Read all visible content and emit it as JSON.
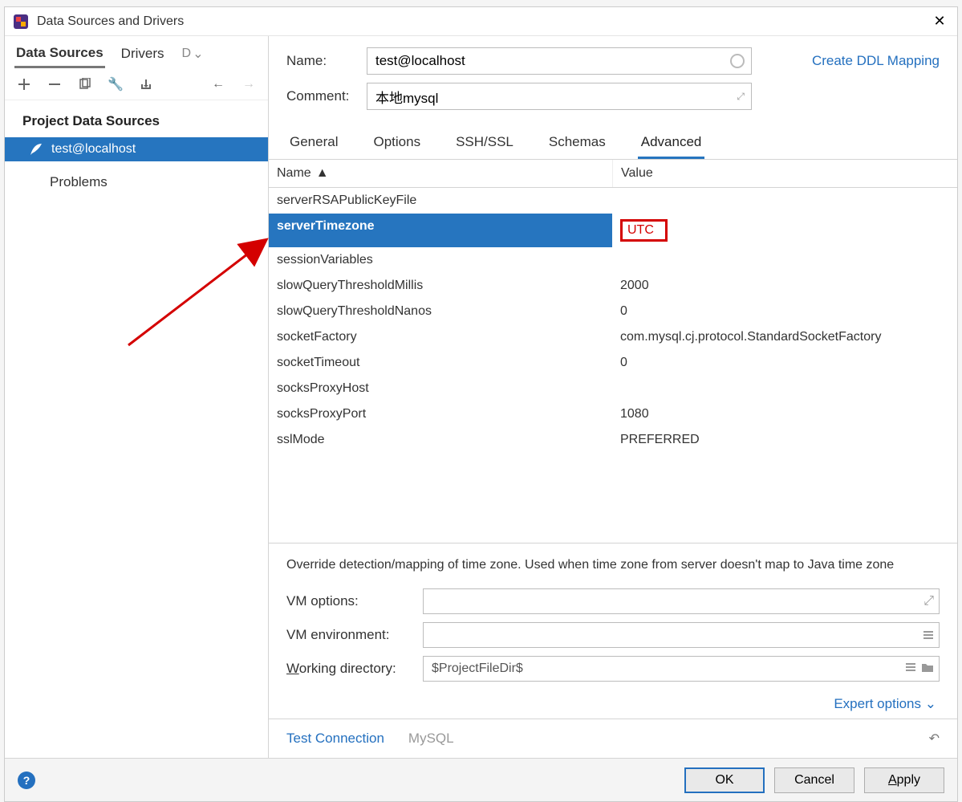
{
  "window": {
    "title": "Data Sources and Drivers"
  },
  "left": {
    "tabs": {
      "datasources": "Data Sources",
      "drivers": "Drivers",
      "ddl": "D"
    },
    "section": "Project Data Sources",
    "item": "test@localhost",
    "problems": "Problems"
  },
  "form": {
    "name_label": "Name:",
    "name_value": "test@localhost",
    "comment_label": "Comment:",
    "comment_value": "本地mysql",
    "ddl_link": "Create DDL Mapping"
  },
  "tabs": {
    "general": "General",
    "options": "Options",
    "ssh": "SSH/SSL",
    "schemas": "Schemas",
    "advanced": "Advanced"
  },
  "table": {
    "col_name": "Name",
    "col_value": "Value",
    "rows": [
      {
        "name": "serverRSAPublicKeyFile",
        "value": ""
      },
      {
        "name": "serverTimezone",
        "value": "UTC",
        "selected": true
      },
      {
        "name": "sessionVariables",
        "value": ""
      },
      {
        "name": "slowQueryThresholdMillis",
        "value": "2000"
      },
      {
        "name": "slowQueryThresholdNanos",
        "value": "0"
      },
      {
        "name": "socketFactory",
        "value": "com.mysql.cj.protocol.StandardSocketFactory"
      },
      {
        "name": "socketTimeout",
        "value": "0"
      },
      {
        "name": "socksProxyHost",
        "value": ""
      },
      {
        "name": "socksProxyPort",
        "value": "1080"
      },
      {
        "name": "sslMode",
        "value": "PREFERRED"
      }
    ]
  },
  "desc": "Override detection/mapping of time zone. Used when time zone from server doesn't map to Java time zone",
  "vm": {
    "options_label": "VM options:",
    "env_label": "VM environment:",
    "wd_label_pre": "W",
    "wd_label_post": "orking directory:",
    "wd_value": "$ProjectFileDir$"
  },
  "expert": "Expert options",
  "foot": {
    "test": "Test Connection",
    "driver": "MySQL"
  },
  "buttons": {
    "ok": "OK",
    "cancel": "Cancel",
    "apply_pre": "A",
    "apply_post": "pply"
  }
}
